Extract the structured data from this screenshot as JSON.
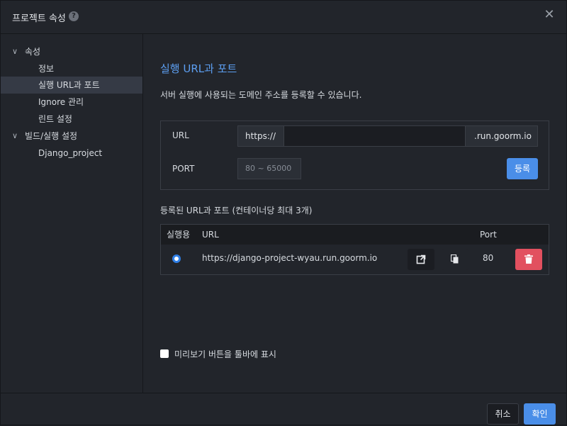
{
  "header": {
    "title": "프로젝트 속성",
    "help_icon": "question-circle-icon",
    "close_icon": "close-icon"
  },
  "sidebar": {
    "items": [
      {
        "label": "속성",
        "expanded": true
      },
      {
        "label": "정보"
      },
      {
        "label": "실행 URL과 포트",
        "selected": true
      },
      {
        "label": "Ignore 관리"
      },
      {
        "label": "린트 설정"
      },
      {
        "label": "빌드/실행 설정",
        "expanded": true
      },
      {
        "label": "Django_project"
      }
    ]
  },
  "main": {
    "title": "실행 URL과 포트",
    "description": "서버 실행에 사용되는 도메인 주소를 등록할 수 있습니다.",
    "form": {
      "url_label": "URL",
      "protocol": "https://",
      "url_value": "",
      "domain_suffix": ".run.goorm.io",
      "port_label": "PORT",
      "port_placeholder": "80 ~ 65000",
      "register_label": "등록"
    },
    "registered_title": "등록된 URL과 포트 (컨테이너당 최대 3개)",
    "table": {
      "headers": [
        "실행용",
        "URL",
        "Port"
      ],
      "rows": [
        {
          "selected": true,
          "url": "https://django-project-wyau.run.goorm.io",
          "port": "80"
        }
      ]
    },
    "preview_checkbox_label": "미리보기 버튼을 툴바에 표시"
  },
  "footer": {
    "cancel_label": "취소",
    "ok_label": "확인"
  },
  "colors": {
    "accent": "#4a8ee8",
    "danger": "#e2505f",
    "title_blue": "#5c9ef0"
  }
}
